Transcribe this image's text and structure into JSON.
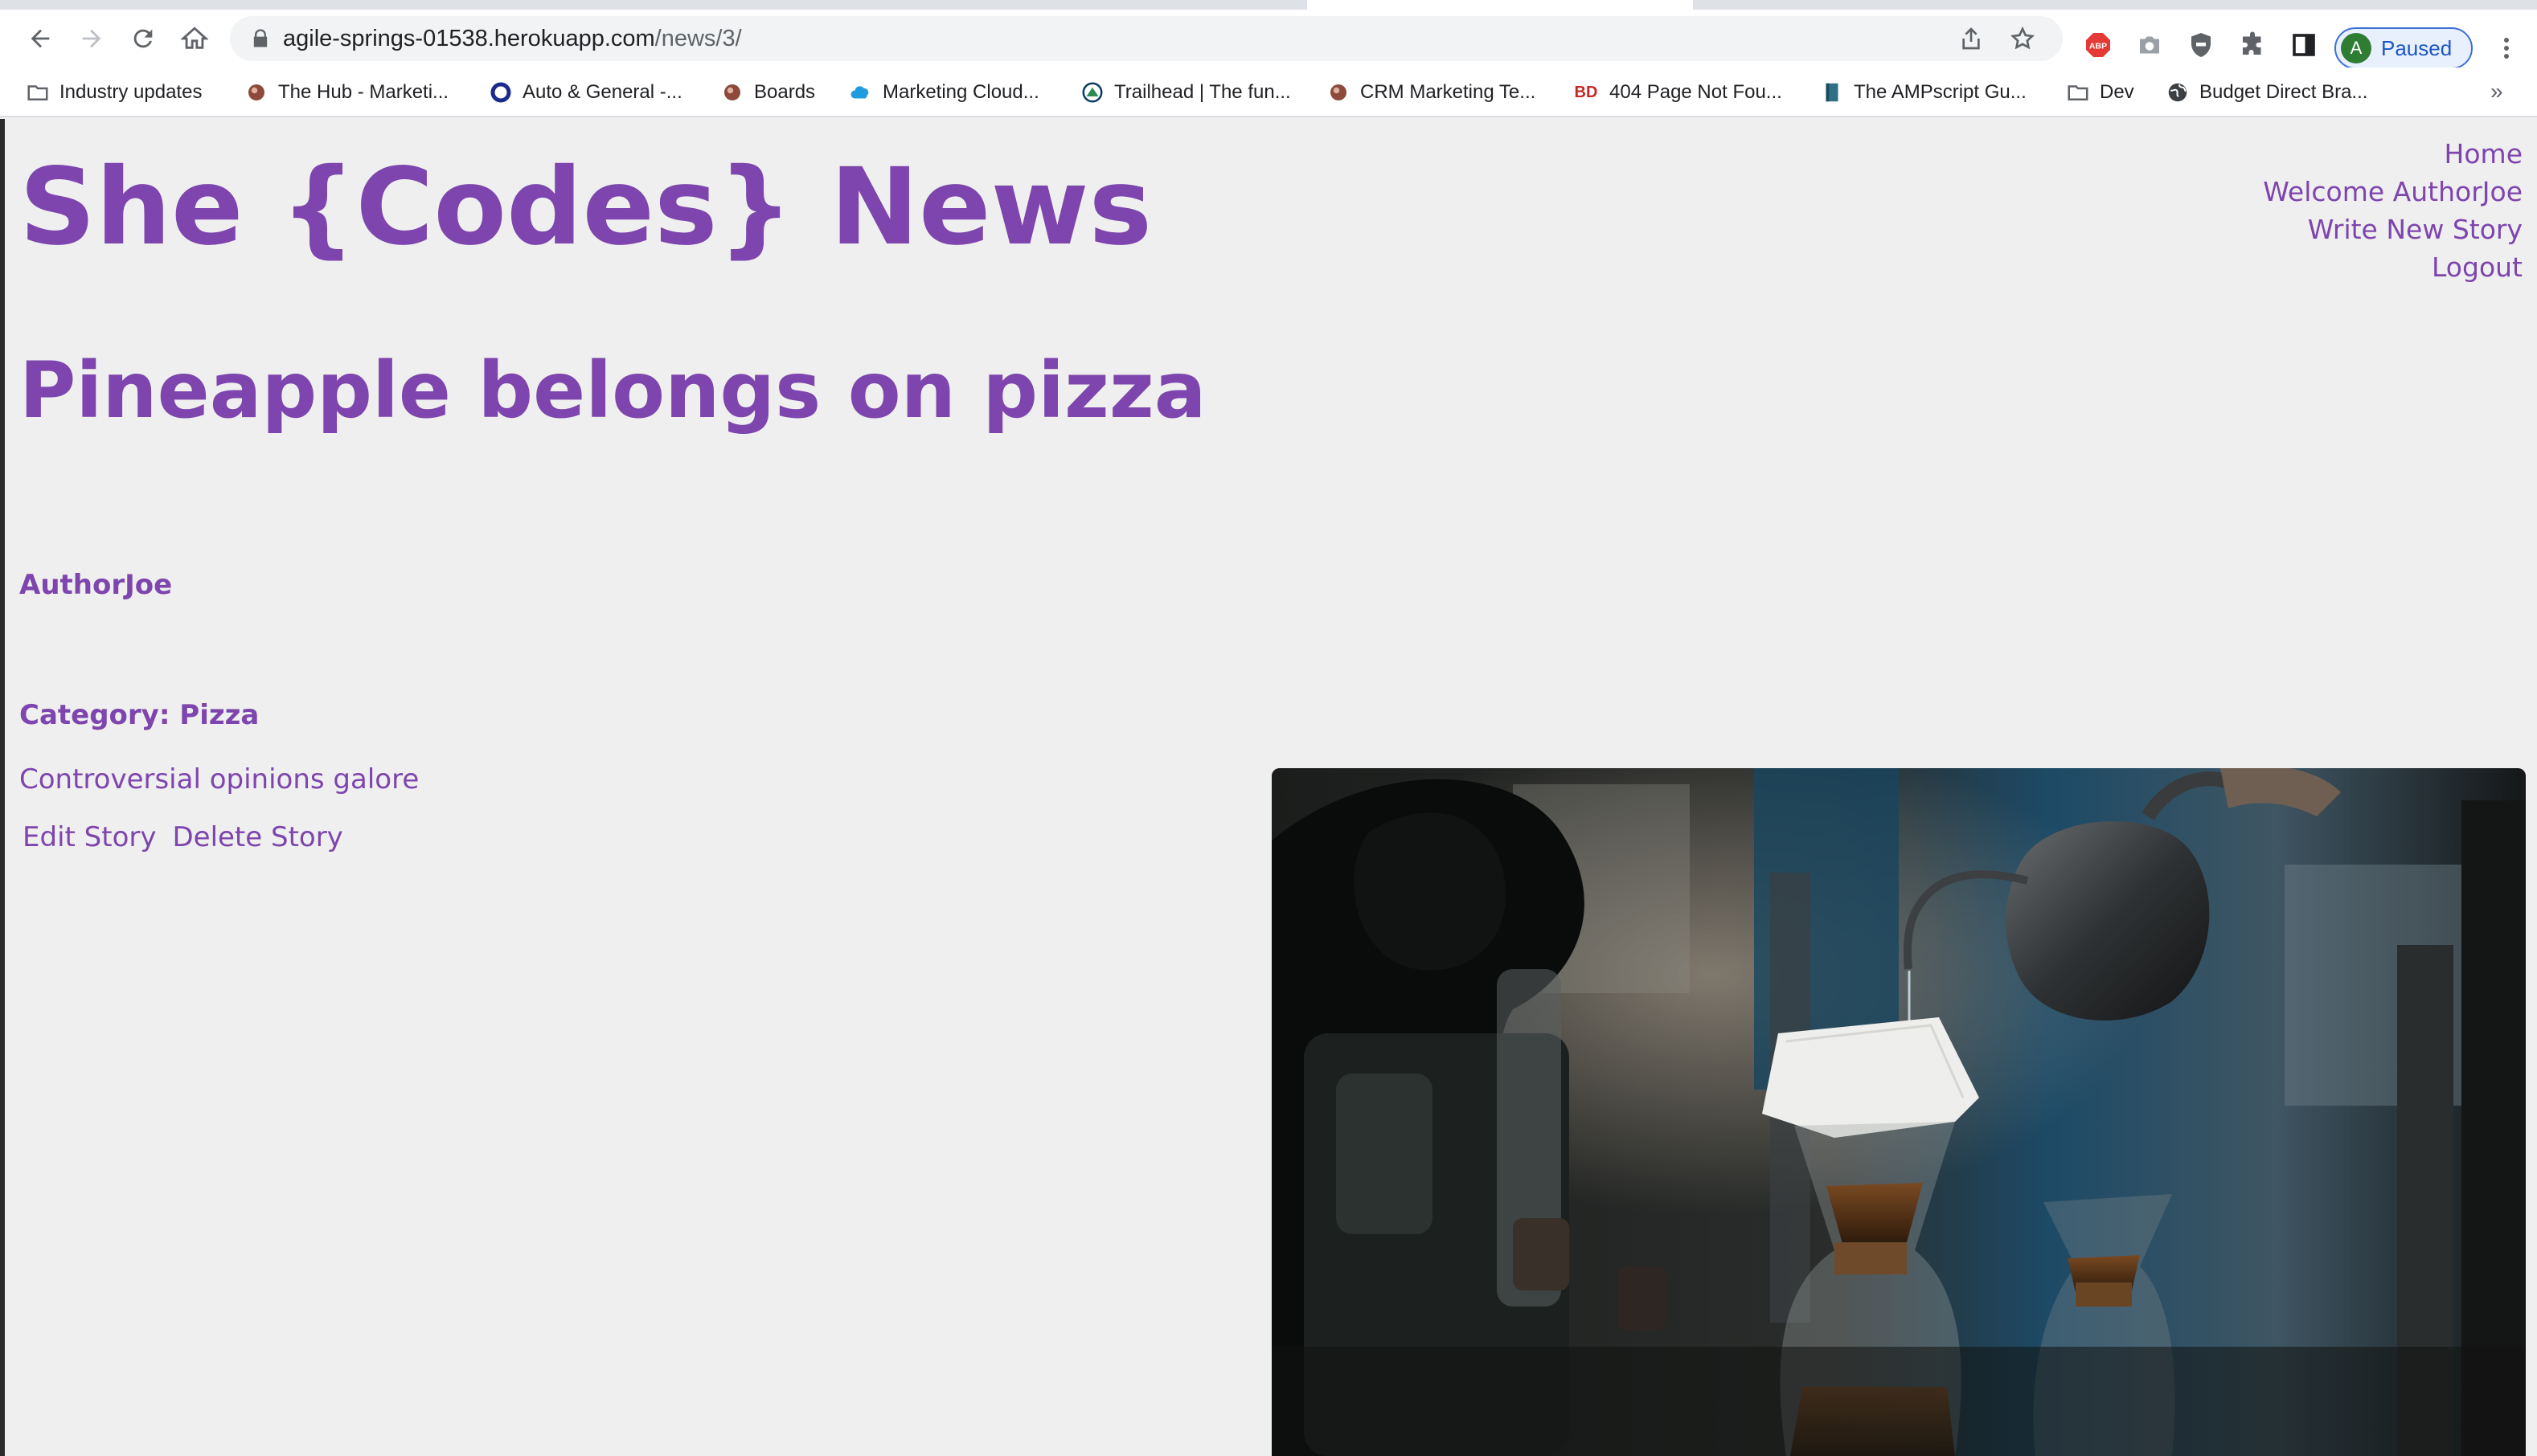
{
  "browser": {
    "url_host": "agile-springs-01538.herokuapp.com",
    "url_path": "/news/3/",
    "profile_initial": "A",
    "profile_status": "Paused",
    "bookmarks": [
      {
        "label": "Industry updates",
        "icon": "folder-icon"
      },
      {
        "label": "The Hub - Marketi...",
        "icon": "site-favicon"
      },
      {
        "label": "Auto & General -...",
        "icon": "ring-favicon"
      },
      {
        "label": "Boards",
        "icon": "site-favicon"
      },
      {
        "label": "Marketing Cloud...",
        "icon": "cloud-favicon"
      },
      {
        "label": "Trailhead | The fun...",
        "icon": "trailhead-favicon"
      },
      {
        "label": "CRM Marketing Te...",
        "icon": "site-favicon"
      },
      {
        "label": "404 Page Not Fou...",
        "icon": "bd-favicon",
        "icon_text": "BD"
      },
      {
        "label": "The AMPscript Gu...",
        "icon": "book-favicon"
      },
      {
        "label": "Dev",
        "icon": "folder-icon"
      },
      {
        "label": "Budget Direct Bra...",
        "icon": "globe-icon"
      }
    ],
    "bookmarks_overflow": "»"
  },
  "site": {
    "title": "She {Codes} News",
    "nav": [
      "Home",
      "Welcome AuthorJoe",
      "Write New Story",
      "Logout"
    ]
  },
  "story": {
    "title": "Pineapple belongs on pizza",
    "author": "AuthorJoe",
    "category_label": "Category:",
    "category_value": "Pizza",
    "summary": "Controversial opinions galore",
    "edit_label": "Edit Story",
    "delete_label": "Delete Story"
  },
  "colors": {
    "accent": "#7d45ad",
    "page_background": "#efefef",
    "profile_border": "#3c6fd6"
  }
}
